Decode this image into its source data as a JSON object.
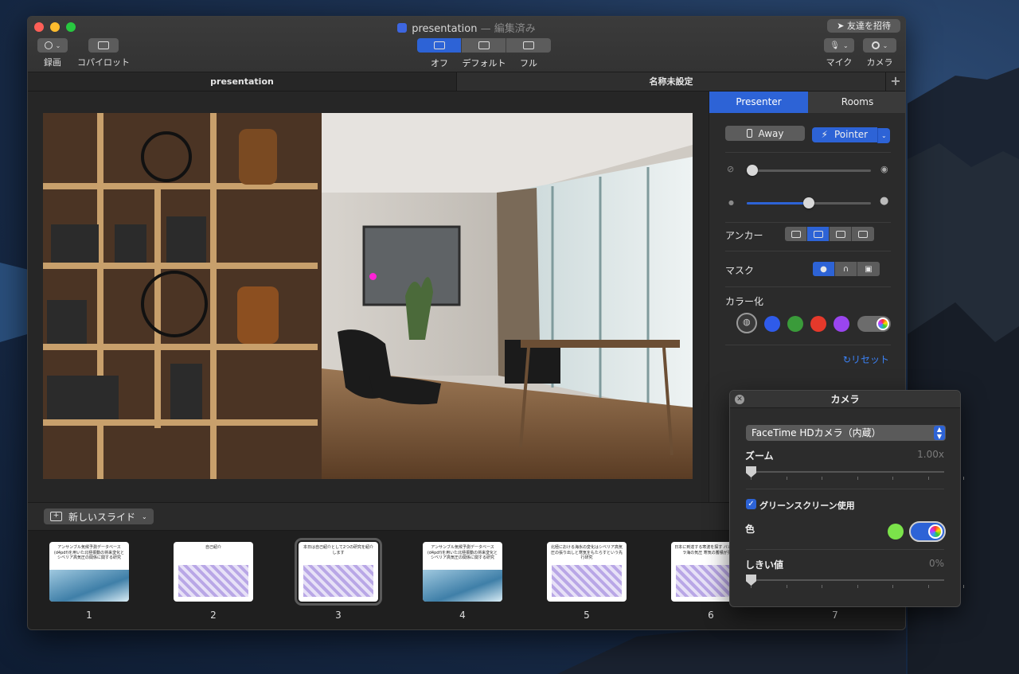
{
  "window": {
    "title": "presentation",
    "title_suffix": "— 編集済み",
    "invite_button": "友達を招待"
  },
  "toolbar": {
    "record_label": "録画",
    "copilot_label": "コパイロット",
    "view_modes": [
      "オフ",
      "デフォルト",
      "フル"
    ],
    "selected_view_mode": "オフ",
    "mic_label": "マイク",
    "camera_label": "カメラ"
  },
  "tabs": [
    {
      "label": "presentation",
      "active": true
    },
    {
      "label": "名称未設定",
      "active": false
    }
  ],
  "panel": {
    "tabs": [
      "Presenter",
      "Rooms"
    ],
    "active_tab": "Presenter",
    "away_button": "Away",
    "pointer_button": "Pointer",
    "opacity_level": 0.0,
    "size_level": 0.5,
    "anchor_label": "アンカー",
    "anchor_selected_index": 1,
    "mask_label": "マスク",
    "mask_selected_index": 0,
    "colorize_label": "カラー化",
    "colors": [
      "#2f5bea",
      "#3a9b3a",
      "#e5392b",
      "#9a45ef"
    ],
    "reset_label": "リセット"
  },
  "slides": {
    "new_slide_button": "新しいスライド",
    "items": [
      {
        "number": "1",
        "title": "アンサンブル気候予測データベース(d4pdf)を用いた北極振動の将来変化とシベリア高気圧の関係に関する研究"
      },
      {
        "number": "2",
        "title": "自己紹介"
      },
      {
        "number": "3",
        "title": "本日は自己紹介として2つの研究を紹介します",
        "selected": true
      },
      {
        "number": "4",
        "title": "アンサンブル気候予測データベース(d4pdf)を用いた北極振動の将来変化とシベリア高気圧の関係に関する研究"
      },
      {
        "number": "5",
        "title": "北極における海氷の変化はシベリア高気圧の張り出しと寒気をもたらすという先行研究"
      },
      {
        "number": "6",
        "title": "日本に到達する寒波を探す バレンツ・カラ海の気圧 寒気の蓄積が見られ"
      },
      {
        "number": "7",
        "title": ""
      }
    ]
  },
  "camera_popup": {
    "title": "カメラ",
    "device": "FaceTime HDカメラ（内蔵）",
    "zoom_label": "ズーム",
    "zoom_value": "1.00x",
    "zoom_level": 0.0,
    "green_screen_label": "グリーンスクリーン使用",
    "green_screen_checked": true,
    "color_label": "色",
    "key_color": "#7be34a",
    "threshold_label": "しきい値",
    "threshold_value": "0%",
    "threshold_level": 0.0
  }
}
